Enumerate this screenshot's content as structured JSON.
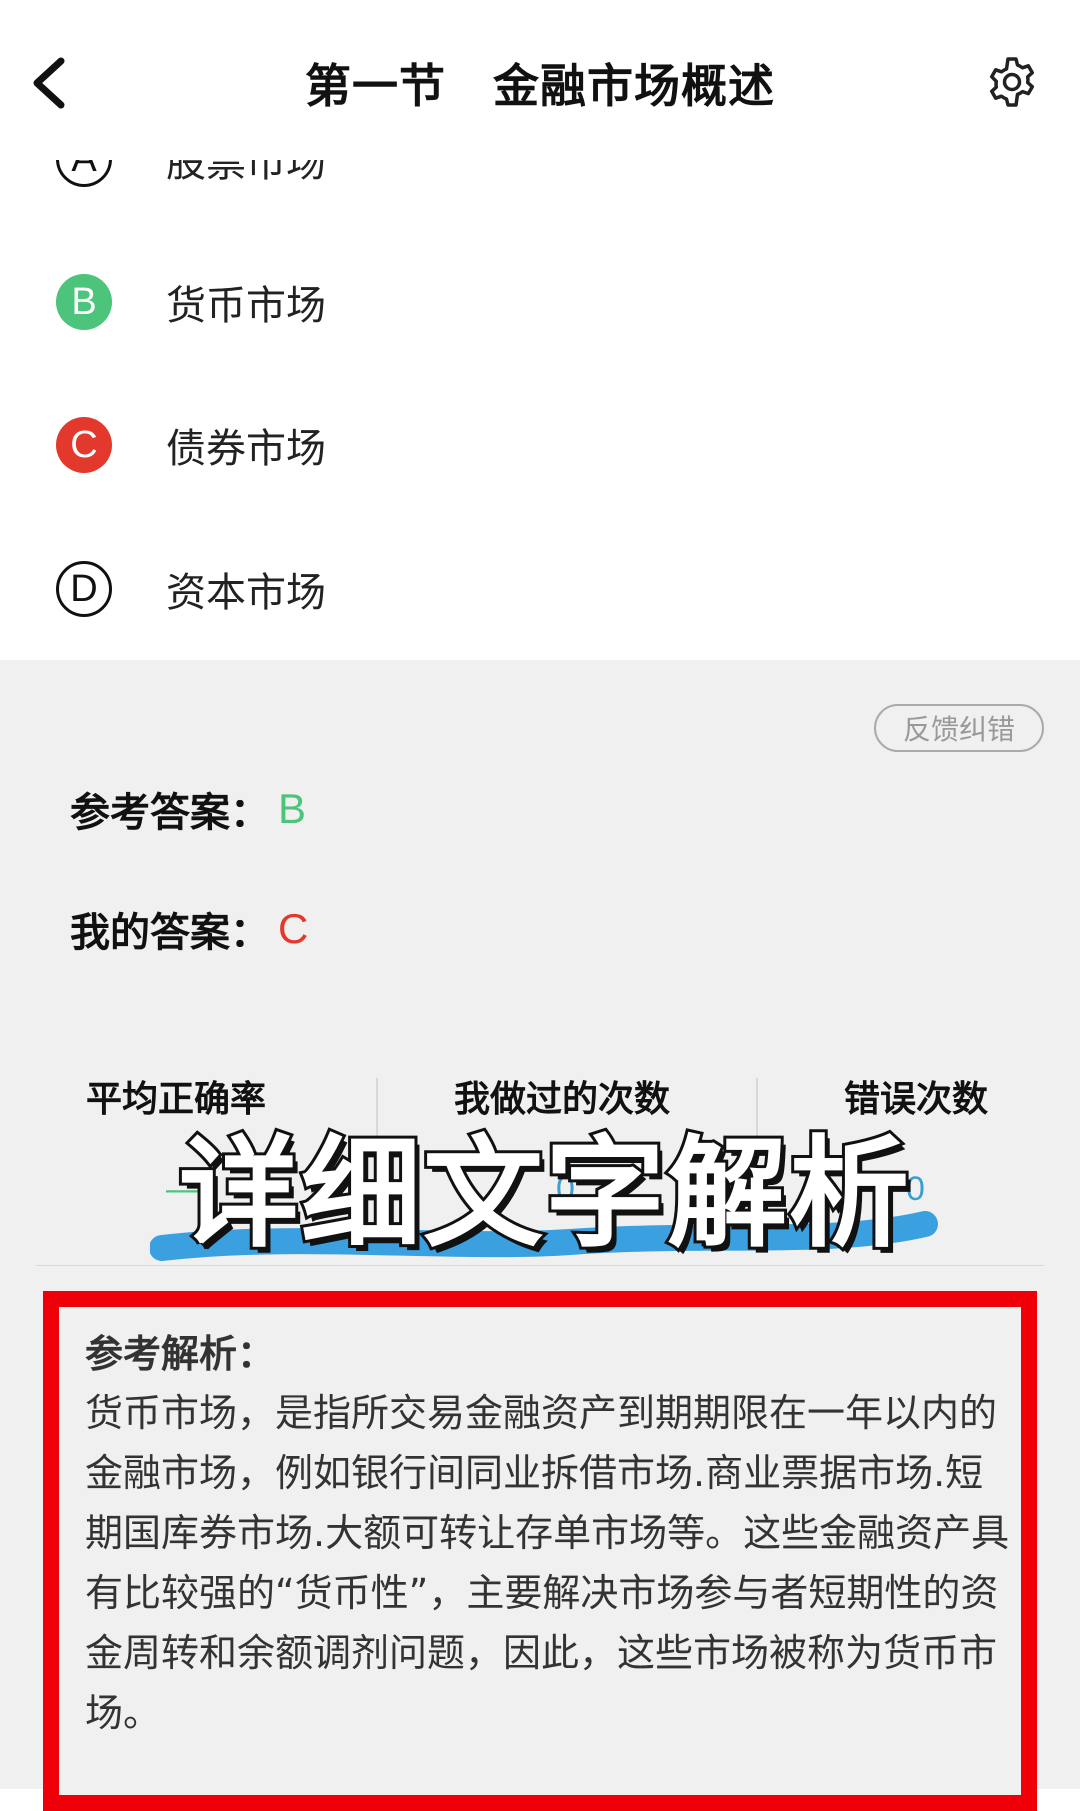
{
  "header": {
    "title": "第一节　金融市场概述",
    "back_icon": "chevron-left-icon",
    "settings_icon": "gear-icon"
  },
  "options": [
    {
      "letter": "A",
      "text": "股票市场",
      "state": "unselected"
    },
    {
      "letter": "B",
      "text": "货币市场",
      "state": "correct"
    },
    {
      "letter": "C",
      "text": "债券市场",
      "state": "wrong"
    },
    {
      "letter": "D",
      "text": "资本市场",
      "state": "unselected"
    }
  ],
  "feedback_label": "反馈纠错",
  "reference_answer": {
    "label": "参考答案：",
    "value": "B"
  },
  "my_answer": {
    "label": "我的答案：",
    "value": "C"
  },
  "stats": {
    "avg_accuracy": {
      "label": "平均正确率",
      "value": "—"
    },
    "times_done": {
      "label": "我做过的次数",
      "value": "0"
    },
    "wrong_count": {
      "label": "错误次数",
      "value": "0"
    }
  },
  "overlay_banner": "详细文字解析",
  "analysis": {
    "title": "参考解析：",
    "body": "货币市场，是指所交易金融资产到期期限在一年以内的金融市场，例如银行间同业拆借市场.商业票据市场.短期国库券市场.大额可转让存单市场等。这些金融资产具有比较强的“货币性”，主要解决市场参与者短期性的资金周转和余额调剂问题，因此，这些市场被称为货币市场。"
  },
  "colors": {
    "correct": "#4cc47b",
    "wrong": "#e2392c",
    "highlight_border": "#ef0008",
    "banner_stroke": "#3aa0e0"
  }
}
